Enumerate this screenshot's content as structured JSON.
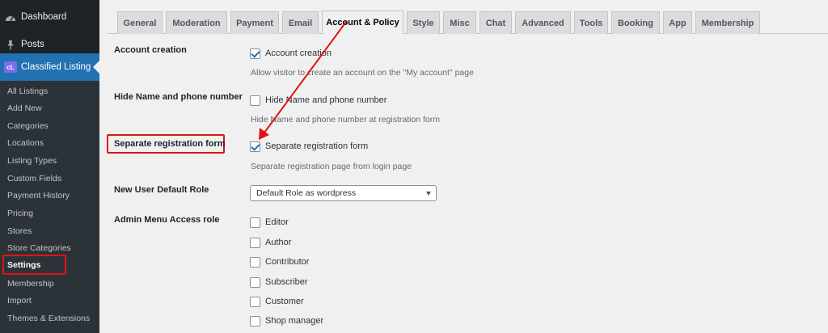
{
  "sidebar": {
    "top_items": [
      {
        "label": "Dashboard",
        "icon": "dashboard-icon"
      },
      {
        "label": "Posts",
        "icon": "pushpin-icon"
      },
      {
        "label": "Classified Listing",
        "icon": "classified-listing-logo",
        "logo_text": "cL"
      }
    ],
    "submenu": [
      {
        "label": "All Listings"
      },
      {
        "label": "Add New"
      },
      {
        "label": "Categories"
      },
      {
        "label": "Locations"
      },
      {
        "label": "Listing Types"
      },
      {
        "label": "Custom Fields"
      },
      {
        "label": "Payment History"
      },
      {
        "label": "Pricing"
      },
      {
        "label": "Stores"
      },
      {
        "label": "Store Categories"
      },
      {
        "label": "Settings"
      },
      {
        "label": "Membership"
      },
      {
        "label": "Import"
      },
      {
        "label": "Themes & Extensions"
      }
    ],
    "active_item": "Settings"
  },
  "tabs": [
    "General",
    "Moderation",
    "Payment",
    "Email",
    "Account & Policy",
    "Style",
    "Misc",
    "Chat",
    "Advanced",
    "Tools",
    "Booking",
    "App",
    "Membership"
  ],
  "active_tab": "Account & Policy",
  "settings": {
    "account_creation": {
      "label": "Account creation",
      "checkbox_label": "Account creation",
      "checked": true,
      "description": "Allow visitor to create an account on the \"My account\" page"
    },
    "hide_name_phone": {
      "label": "Hide Name and phone number",
      "checkbox_label": "Hide Name and phone number",
      "checked": false,
      "description": "Hide Name and phone number at registration form"
    },
    "separate_registration": {
      "label": "Separate registration form",
      "checkbox_label": "Separate registration form",
      "checked": true,
      "description": "Separate registration page from login page"
    },
    "default_role": {
      "label": "New User Default Role",
      "selected": "Default Role as wordpress"
    },
    "admin_menu_access": {
      "label": "Admin Menu Access role",
      "options": [
        {
          "label": "Editor",
          "checked": false
        },
        {
          "label": "Author",
          "checked": false
        },
        {
          "label": "Contributor",
          "checked": false
        },
        {
          "label": "Subscriber",
          "checked": false
        },
        {
          "label": "Customer",
          "checked": false
        },
        {
          "label": "Shop manager",
          "checked": false
        }
      ]
    }
  },
  "colors": {
    "sidebar_bg": "#1d2327",
    "submenu_bg": "#2c3338",
    "accent": "#2271b1",
    "highlight_red": "#e0140f",
    "logo": "#7b6cf0"
  }
}
